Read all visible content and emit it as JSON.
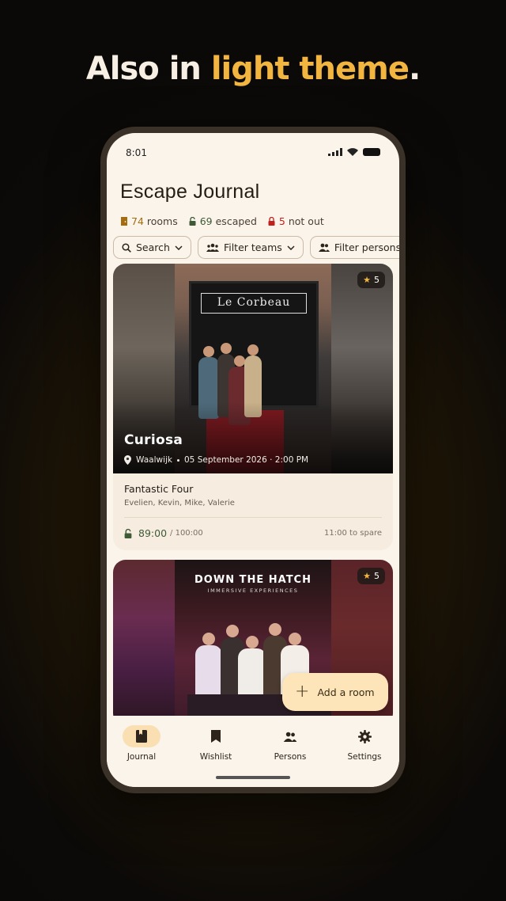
{
  "headline": {
    "part1": "Also in ",
    "accent": "light theme",
    "part2": "."
  },
  "status_bar": {
    "time": "8:01"
  },
  "app": {
    "title": "Escape Journal"
  },
  "stats": {
    "rooms_value": "74",
    "rooms_label": " rooms",
    "escaped_value": "69",
    "escaped_label": " escaped",
    "notout_value": "5",
    "notout_label": " not out"
  },
  "filters": {
    "search": "Search",
    "teams": "Filter teams",
    "persons": "Filter persons"
  },
  "rooms": [
    {
      "rating": "5",
      "name": "Curiosa",
      "location": "Waalwijk",
      "datetime": "05 September 2026 · 2:00 PM",
      "storefront_sign": "Le Corbeau",
      "team": "Fantastic Four",
      "members": "Evelien, Kevin, Mike, Valerie",
      "time_used": "89:00",
      "time_total": "/ 100:00",
      "spare": "11:00 to spare"
    },
    {
      "rating": "5",
      "photo_title": "DOWN THE HATCH",
      "photo_subtitle": "IMMERSIVE EXPERIENCES"
    }
  ],
  "fab": {
    "label": "Add a room"
  },
  "nav": [
    {
      "label": "Journal",
      "icon": "book-icon",
      "active": true
    },
    {
      "label": "Wishlist",
      "icon": "bookmark-icon"
    },
    {
      "label": "Persons",
      "icon": "people-icon"
    },
    {
      "label": "Settings",
      "icon": "gear-icon"
    }
  ],
  "colors": {
    "accent": "#f2b640",
    "background": "#fbf4ea",
    "escaped_green": "#3f5a36",
    "not_out_red": "#c0201e",
    "fab": "#fde5b9"
  }
}
